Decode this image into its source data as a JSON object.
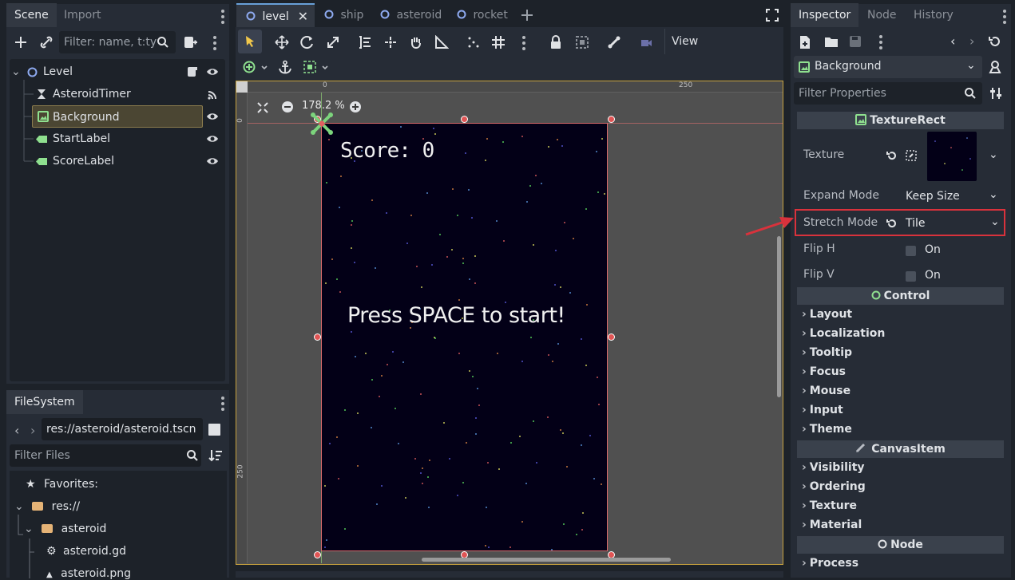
{
  "scene_panel": {
    "tabs": [
      "Scene",
      "Import"
    ],
    "filter_placeholder": "Filter: name, t:ty",
    "tree": [
      {
        "label": "Level"
      },
      {
        "label": "AsteroidTimer"
      },
      {
        "label": "Background"
      },
      {
        "label": "StartLabel"
      },
      {
        "label": "ScoreLabel"
      }
    ]
  },
  "filesystem": {
    "tab": "FileSystem",
    "path": "res://asteroid/asteroid.tscn",
    "filter_placeholder": "Filter Files",
    "items": [
      "Favorites:",
      "res://",
      "asteroid",
      "asteroid.gd",
      "asteroid.png"
    ]
  },
  "editor_tabs": [
    "level",
    "ship",
    "asteroid",
    "rocket"
  ],
  "toolbar": {
    "view_label": "View"
  },
  "viewport": {
    "zoom": "178.2 %",
    "ruler_top": [
      "0",
      "250"
    ],
    "ruler_left": [
      "0",
      "250"
    ],
    "score_text": "Score: 0",
    "start_text": "Press SPACE to start!"
  },
  "inspector": {
    "tabs": [
      "Inspector",
      "Node",
      "History"
    ],
    "node_name": "Background",
    "filter_placeholder": "Filter Properties",
    "class_header": "TextureRect",
    "props": {
      "texture_label": "Texture",
      "expand_label": "Expand Mode",
      "expand_value": "Keep Size",
      "stretch_label": "Stretch Mode",
      "stretch_value": "Tile",
      "fliph_label": "Flip H",
      "fliph_value": "On",
      "flipv_label": "Flip V",
      "flipv_value": "On"
    },
    "control_header": "Control",
    "control_groups": [
      "Layout",
      "Localization",
      "Tooltip",
      "Focus",
      "Mouse",
      "Input",
      "Theme"
    ],
    "canvas_header": "CanvasItem",
    "canvas_groups": [
      "Visibility",
      "Ordering",
      "Texture",
      "Material"
    ],
    "node_header": "Node",
    "node_groups": [
      "Process"
    ]
  },
  "colors": {
    "accent": "#68a0d8",
    "highlight": "#d9323c",
    "selection": "#8c7d4e"
  }
}
